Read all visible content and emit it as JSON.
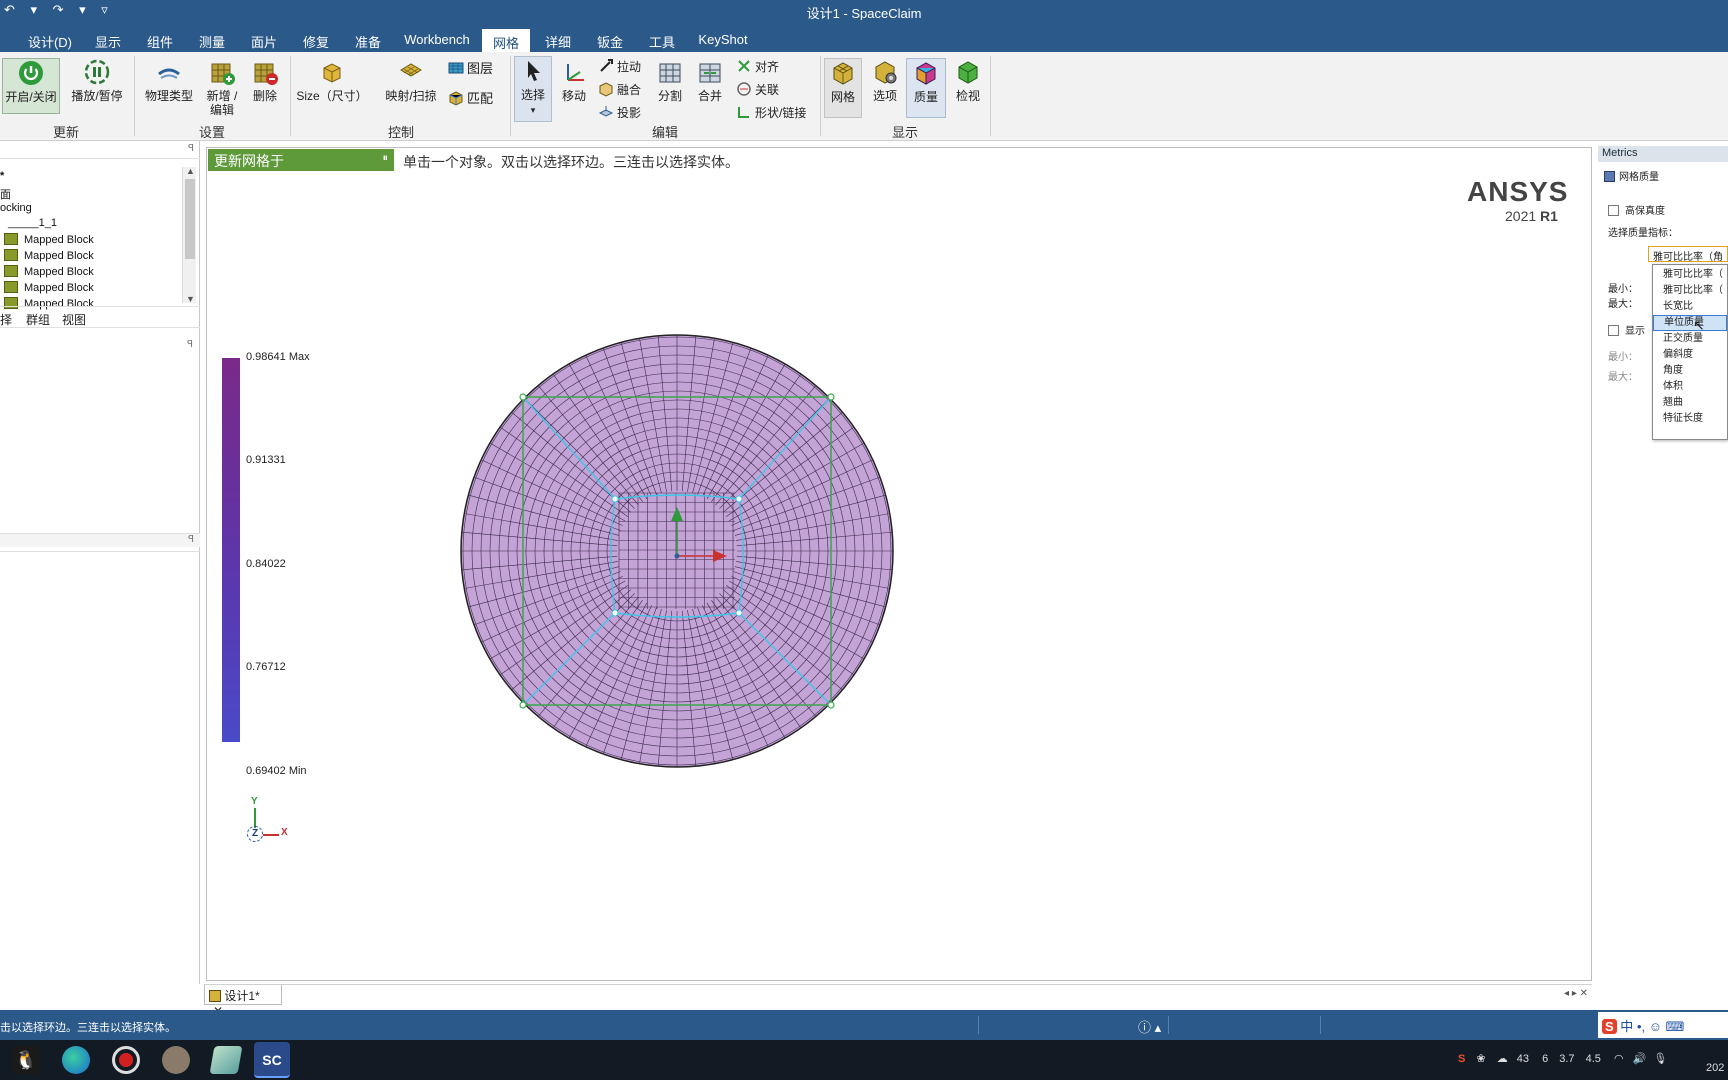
{
  "window": {
    "title": "设计1 - SpaceClaim"
  },
  "menu_tabs": [
    {
      "label": "设计(D)",
      "active": false
    },
    {
      "label": "显示",
      "active": false
    },
    {
      "label": "组件",
      "active": false
    },
    {
      "label": "测量",
      "active": false
    },
    {
      "label": "面片",
      "active": false
    },
    {
      "label": "修复",
      "active": false
    },
    {
      "label": "准备",
      "active": false
    },
    {
      "label": "Workbench",
      "active": false
    },
    {
      "label": "网格",
      "active": true
    },
    {
      "label": "详细",
      "active": false
    },
    {
      "label": "钣金",
      "active": false
    },
    {
      "label": "工具",
      "active": false
    },
    {
      "label": "KeyShot",
      "active": false
    }
  ],
  "ribbon": {
    "update": {
      "group": "更新",
      "on_off": "开启/关闭",
      "play_pause": "播放/暂停"
    },
    "settings": {
      "group": "设置",
      "physics_type": "物理类型",
      "new_edit_1": "新增 /",
      "new_edit_2": "编辑",
      "delete": "删除"
    },
    "control": {
      "group": "控制",
      "size": "Size（尺寸）",
      "map_sweep": "映射/扫掠",
      "layer": "图层",
      "match": "匹配"
    },
    "edit": {
      "group": "编辑",
      "select": "选择",
      "move": "移动",
      "pull": "拉动",
      "blend": "融合",
      "project": "投影",
      "split": "分割",
      "merge": "合并",
      "align": "对齐",
      "relate": "关联",
      "shape_link": "形状/链接"
    },
    "display": {
      "group": "显示",
      "mesh": "网格",
      "options": "选项",
      "quality": "质量",
      "inspect": "检视"
    }
  },
  "left_panel": {
    "tree_items": [
      "*",
      "面",
      "ocking",
      "_____1_1"
    ],
    "blocks": [
      "Mapped Block",
      "Mapped Block",
      "Mapped Block",
      "Mapped Block",
      "Mapped Block"
    ],
    "tabs": [
      "择",
      "群组",
      "视图"
    ]
  },
  "viewport": {
    "mode_banner": "更新网格于",
    "hint": "单击一个对象。双击以选择环边。三连击以选择实体。",
    "logo_main": "ANSYS",
    "logo_version": "2021",
    "logo_release": "R1",
    "legend": {
      "max": "0.98641 Max",
      "v2": "0.91331",
      "v3": "0.84022",
      "v4": "0.76712",
      "min": "0.69402 Min"
    },
    "axis": {
      "y": "Y",
      "z": "Z",
      "x": "X"
    },
    "doc_tab": "设计1*"
  },
  "right_panel": {
    "title": "Metrics",
    "item": "网格质量",
    "high_fidelity": "高保真度",
    "select_metric_label": "选择质量指标：",
    "selected_value": "雅可比比率（角",
    "min_label": "最小：",
    "max_label": "最大：",
    "show_label": "显示",
    "min_label2": "最小：",
    "max_label2": "最大：",
    "dropdown_options": [
      "雅可比比率（",
      "雅可比比率（",
      "长宽比",
      "单位质量",
      "正交质量",
      "偏斜度",
      "角度",
      "体积",
      "翘曲",
      "特征长度"
    ],
    "dropdown_selected_index": 3
  },
  "status": {
    "text": "击以选择环边。三连击以选择实体。"
  },
  "tray": {
    "ime": "中",
    "nums": [
      "43",
      "6",
      "3.7",
      "4.5"
    ],
    "date": "202"
  },
  "colors": {
    "accent": "#2b5a8a",
    "mesh_fill": "#c4a3d6",
    "block_green": "#4a9b2e",
    "inner_cyan": "#3ec5e8"
  }
}
